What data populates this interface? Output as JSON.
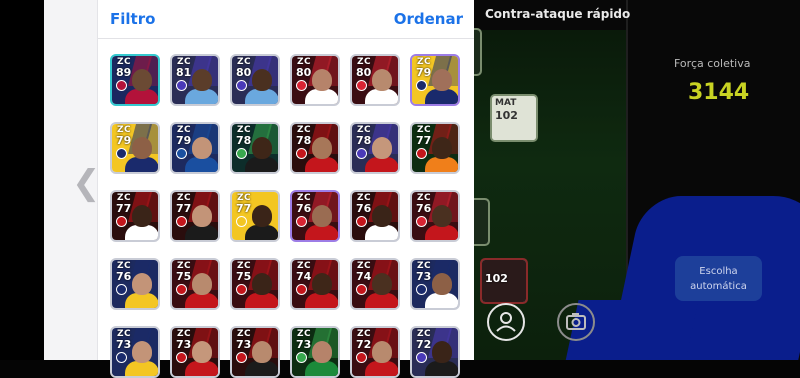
{
  "list": {
    "filter_label": "Filtro",
    "sort_label": "Ordenar",
    "back_icon": "chevron-left-icon"
  },
  "cards": [
    {
      "pos": "ZC",
      "ovr": "89",
      "bg": "#1a2860",
      "kit": "#b3123a",
      "skin": "#6b4a34",
      "accent": "#b3123a",
      "selected": true
    },
    {
      "pos": "ZC",
      "ovr": "81",
      "bg": "#2a2d56",
      "kit": "#6aa8de",
      "skin": "#5b3d2a",
      "accent": "#4a3ab8"
    },
    {
      "pos": "ZC",
      "ovr": "80",
      "bg": "#2a2d56",
      "kit": "#6aa8de",
      "skin": "#4a3020",
      "accent": "#4a3ab8"
    },
    {
      "pos": "ZC",
      "ovr": "80",
      "bg": "#3a0d12",
      "kit": "#ffffff",
      "skin": "#b6836a",
      "accent": "#d82433"
    },
    {
      "pos": "ZC",
      "ovr": "80",
      "bg": "#3a0d12",
      "kit": "#ffffff",
      "skin": "#b88a6e",
      "accent": "#d82433"
    },
    {
      "pos": "ZC",
      "ovr": "79",
      "bg": "#f3c623",
      "kit": "#1a2a6c",
      "skin": "#a0705a",
      "accent": "#1a2a6c",
      "highlight": true
    },
    {
      "pos": "ZC",
      "ovr": "79",
      "bg": "#f3c623",
      "kit": "#1a2a6c",
      "skin": "#8d6046",
      "accent": "#1a2a6c"
    },
    {
      "pos": "ZC",
      "ovr": "79",
      "bg": "#1d2a5f",
      "kit": "#1a4fa0",
      "skin": "#c39478",
      "accent": "#1a4fa0"
    },
    {
      "pos": "ZC",
      "ovr": "78",
      "bg": "#0d2d2a",
      "kit": "#1b1b1b",
      "skin": "#3e2618",
      "accent": "#38a84e"
    },
    {
      "pos": "ZC",
      "ovr": "78",
      "bg": "#2a0d0d",
      "kit": "#c4161c",
      "skin": "#a77759",
      "accent": "#c4161c"
    },
    {
      "pos": "ZC",
      "ovr": "78",
      "bg": "#2a2d56",
      "kit": "#c4161c",
      "skin": "#c5977b",
      "accent": "#4a3ab8"
    },
    {
      "pos": "ZC",
      "ovr": "77",
      "bg": "#0d2d12",
      "kit": "#f07f1a",
      "skin": "#3e2618",
      "accent": "#c4161c"
    },
    {
      "pos": "ZC",
      "ovr": "77",
      "bg": "#2a0d0d",
      "kit": "#ffffff",
      "skin": "#3a2418",
      "accent": "#c4161c"
    },
    {
      "pos": "ZC",
      "ovr": "77",
      "bg": "#2a0d0d",
      "kit": "#1b1b1b",
      "skin": "#c39478",
      "accent": "#c4161c"
    },
    {
      "pos": "ZC",
      "ovr": "77",
      "bg": "#f3c623",
      "kit": "#1b1b1b",
      "skin": "#3a2418",
      "accent": "#f3c623"
    },
    {
      "pos": "ZC",
      "ovr": "76",
      "bg": "#3a0d12",
      "kit": "#c4161c",
      "skin": "#9a6c52",
      "accent": "#d82433",
      "highlight": true
    },
    {
      "pos": "ZC",
      "ovr": "76",
      "bg": "#2a0d0d",
      "kit": "#ffffff",
      "skin": "#3a2418",
      "accent": "#c4161c"
    },
    {
      "pos": "ZC",
      "ovr": "76",
      "bg": "#3a0d12",
      "kit": "#c4161c",
      "skin": "#4a3020",
      "accent": "#d82433"
    },
    {
      "pos": "ZC",
      "ovr": "76",
      "bg": "#1d2a5f",
      "kit": "#f3c623",
      "skin": "#c39478",
      "accent": "#1a2a6c"
    },
    {
      "pos": "ZC",
      "ovr": "75",
      "bg": "#3a0d12",
      "kit": "#c4161c",
      "skin": "#b88a6e",
      "accent": "#c4161c"
    },
    {
      "pos": "ZC",
      "ovr": "75",
      "bg": "#3a0d12",
      "kit": "#c4161c",
      "skin": "#3a2418",
      "accent": "#c4161c"
    },
    {
      "pos": "ZC",
      "ovr": "74",
      "bg": "#3a0d12",
      "kit": "#c4161c",
      "skin": "#3e2618",
      "accent": "#c4161c"
    },
    {
      "pos": "ZC",
      "ovr": "74",
      "bg": "#3a0d12",
      "kit": "#c4161c",
      "skin": "#4a3020",
      "accent": "#c4161c"
    },
    {
      "pos": "ZC",
      "ovr": "73",
      "bg": "#1d2a5f",
      "kit": "#ffffff",
      "skin": "#8d6046",
      "accent": "#1a2a6c"
    },
    {
      "pos": "ZC",
      "ovr": "73",
      "bg": "#1d2a5f",
      "kit": "#f3c623",
      "skin": "#c39478",
      "accent": "#1a2a6c"
    },
    {
      "pos": "ZC",
      "ovr": "73",
      "bg": "#2a0d0d",
      "kit": "#c4161c",
      "skin": "#c5977b",
      "accent": "#c4161c"
    },
    {
      "pos": "ZC",
      "ovr": "73",
      "bg": "#2a0d0d",
      "kit": "#1b1b1b",
      "skin": "#b88a6e",
      "accent": "#c4161c"
    },
    {
      "pos": "ZC",
      "ovr": "73",
      "bg": "#0d2d12",
      "kit": "#1b8a3a",
      "skin": "#b6836a",
      "accent": "#38a84e"
    },
    {
      "pos": "ZC",
      "ovr": "72",
      "bg": "#3a0d12",
      "kit": "#c4161c",
      "skin": "#b88a6e",
      "accent": "#c4161c"
    },
    {
      "pos": "ZC",
      "ovr": "72",
      "bg": "#2a2d56",
      "kit": "#1b1b1b",
      "skin": "#3a2418",
      "accent": "#4a3ab8"
    }
  ],
  "pitch": {
    "title": "Contra-ataque rápido",
    "team_strength_label": "Força coletiva",
    "team_strength_value": "3144",
    "auto_button_label": "Escolha automática",
    "profile_icon": "person-icon",
    "camera_icon": "camera-icon",
    "pitch_cards": [
      {
        "pos": "MAT",
        "ovr": "102",
        "bg": "#dfe3d6"
      },
      {
        "pos": "",
        "ovr": "102",
        "bg": "#2a1a1a"
      },
      {
        "pos": "",
        "ovr": "",
        "bg": "#1a2a1a"
      },
      {
        "pos": "",
        "ovr": "",
        "bg": "#1a2a1a"
      }
    ]
  },
  "colors": {
    "accent_blue": "#1b72e8",
    "strength_yellow": "#c8d323",
    "selected_border": "#35c9cf",
    "highlight_border": "#9d7de6"
  }
}
